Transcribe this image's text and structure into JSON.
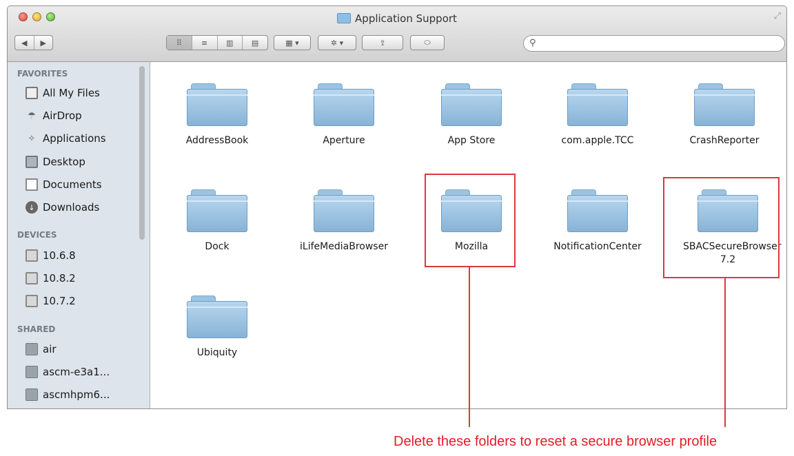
{
  "window": {
    "title": "Application Support"
  },
  "toolbar": {
    "back_label": "◀",
    "forward_label": "▶",
    "view_icons_label": "⠿",
    "view_list_label": "≡",
    "view_columns_label": "▥",
    "view_coverflow_label": "▤",
    "arrange_label": "▦ ▾",
    "action_label": "✲ ▾",
    "share_label": "⇪",
    "tags_label": "⬭",
    "search_placeholder": ""
  },
  "sidebar": {
    "favorites_heading": "FAVORITES",
    "favorites": [
      {
        "label": "All My Files",
        "icon": "files-icon"
      },
      {
        "label": "AirDrop",
        "icon": "airdrop-icon"
      },
      {
        "label": "Applications",
        "icon": "applications-icon"
      },
      {
        "label": "Desktop",
        "icon": "desktop-icon"
      },
      {
        "label": "Documents",
        "icon": "documents-icon"
      },
      {
        "label": "Downloads",
        "icon": "downloads-icon"
      }
    ],
    "devices_heading": "DEVICES",
    "devices": [
      {
        "label": "10.6.8",
        "icon": "disk-icon"
      },
      {
        "label": "10.8.2",
        "icon": "disk-icon"
      },
      {
        "label": "10.7.2",
        "icon": "disk-icon"
      }
    ],
    "shared_heading": "SHARED",
    "shared": [
      {
        "label": "air",
        "icon": "computer-icon"
      },
      {
        "label": "ascm-e3a1...",
        "icon": "computer-icon"
      },
      {
        "label": "ascmhpm6...",
        "icon": "computer-icon"
      }
    ]
  },
  "folders": [
    {
      "name": "AddressBook"
    },
    {
      "name": "Aperture"
    },
    {
      "name": "App Store"
    },
    {
      "name": "com.apple.TCC"
    },
    {
      "name": "CrashReporter"
    },
    {
      "name": "Dock"
    },
    {
      "name": "iLifeMediaBrowser"
    },
    {
      "name": "Mozilla"
    },
    {
      "name": "NotificationCenter"
    },
    {
      "name": "SBACSecureBrowser 7.2"
    },
    {
      "name": "Ubiquity"
    }
  ],
  "annotation": {
    "text": "Delete these folders to reset a secure browser profile",
    "color": "#e31c25"
  }
}
